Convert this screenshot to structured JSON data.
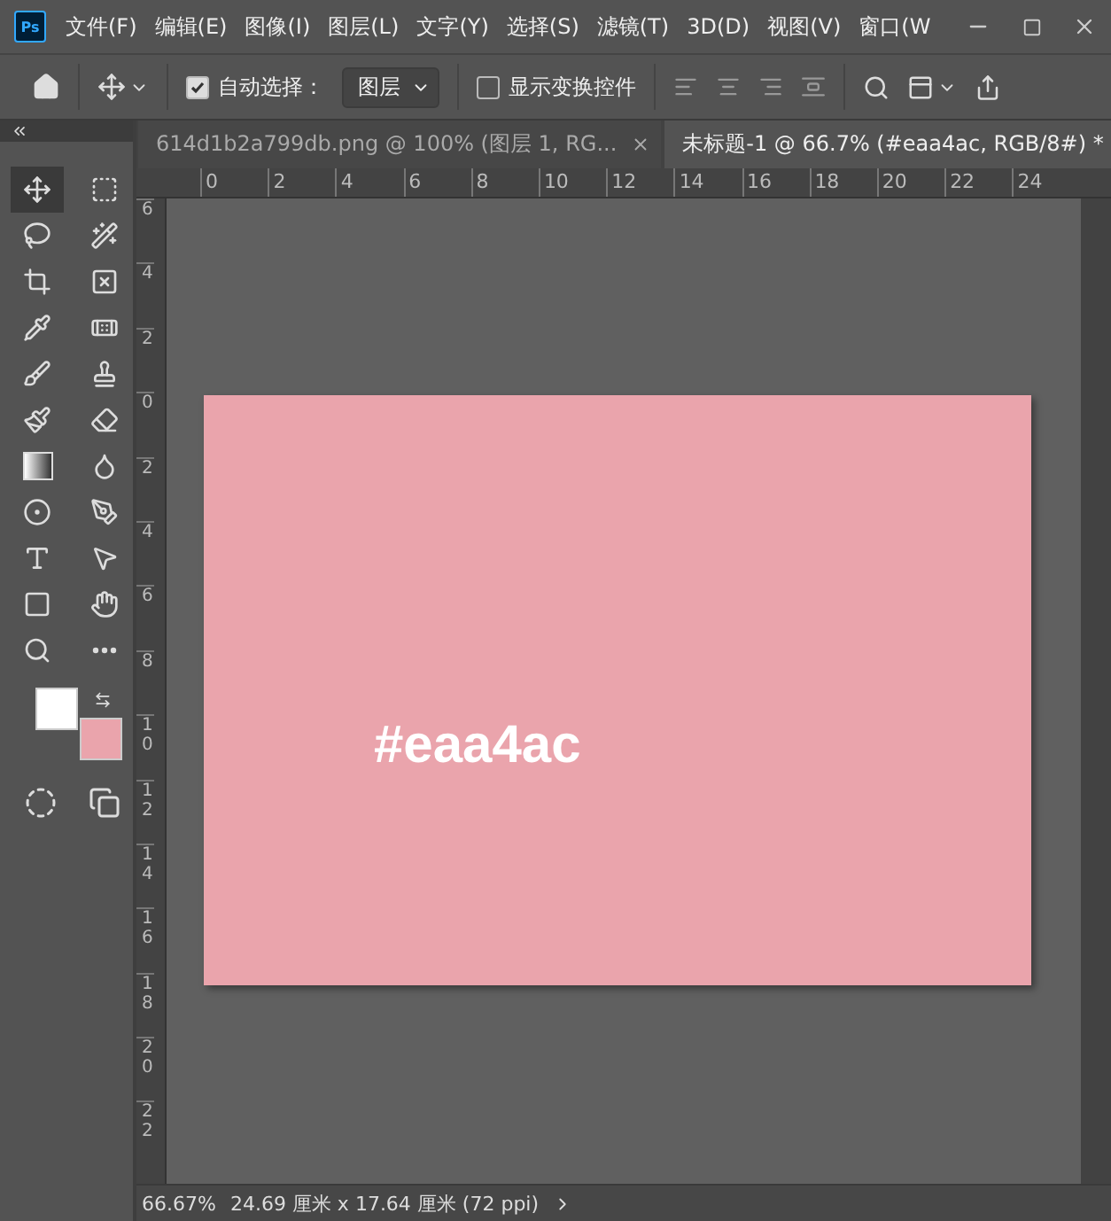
{
  "app_logo": "Ps",
  "menu": [
    "文件(F)",
    "编辑(E)",
    "图像(I)",
    "图层(L)",
    "文字(Y)",
    "选择(S)",
    "滤镜(T)",
    "3D(D)",
    "视图(V)",
    "窗口(W"
  ],
  "options_bar": {
    "auto_select": {
      "label": "自动选择：",
      "checked": true
    },
    "auto_select_target": "图层",
    "show_transform": {
      "label": "显示变换控件",
      "checked": false
    }
  },
  "tabs": [
    {
      "label": "614d1b2a799db.png @ 100% (图层 1, RG...",
      "selected": false
    },
    {
      "label": "未标题-1 @ 66.7% (#eaa4ac, RGB/8#) *",
      "selected": true
    }
  ],
  "tools": [
    {
      "kind": "move",
      "selected": true
    },
    {
      "kind": "marquee",
      "selected": false
    },
    {
      "kind": "lasso",
      "selected": false
    },
    {
      "kind": "wand",
      "selected": false
    },
    {
      "kind": "crop",
      "selected": false
    },
    {
      "kind": "frame",
      "selected": false
    },
    {
      "kind": "eyedropper",
      "selected": false
    },
    {
      "kind": "patch",
      "selected": false
    },
    {
      "kind": "brush",
      "selected": false
    },
    {
      "kind": "stamp",
      "selected": false
    },
    {
      "kind": "history",
      "selected": false
    },
    {
      "kind": "eraser",
      "selected": false
    },
    {
      "kind": "gradient",
      "selected": false
    },
    {
      "kind": "blur",
      "selected": false
    },
    {
      "kind": "dodge",
      "selected": false
    },
    {
      "kind": "pen",
      "selected": false
    },
    {
      "kind": "type",
      "selected": false
    },
    {
      "kind": "select",
      "selected": false
    },
    {
      "kind": "shape",
      "selected": false
    },
    {
      "kind": "hand",
      "selected": false
    },
    {
      "kind": "zoom",
      "selected": false
    },
    {
      "kind": "more",
      "selected": false
    }
  ],
  "swatches": [
    {
      "kind": "foreground",
      "color": "#ffffff"
    },
    {
      "kind": "background",
      "color": "#eaa4ac"
    }
  ],
  "rulers": {
    "horizontal": [
      "0",
      "2",
      "4",
      "6",
      "8",
      "10",
      "12",
      "14",
      "16",
      "18",
      "20",
      "22",
      "24"
    ],
    "vertical": [
      "6",
      "4",
      "2",
      "0",
      "2",
      "4",
      "6",
      "8",
      "10",
      "12",
      "14",
      "16",
      "18",
      "20",
      "22"
    ]
  },
  "document": {
    "text": "#eaa4ac"
  },
  "status_bar": {
    "zoom": "66.67%",
    "size": "24.69 厘米 x 17.64 厘米 (72 ppi)"
  }
}
